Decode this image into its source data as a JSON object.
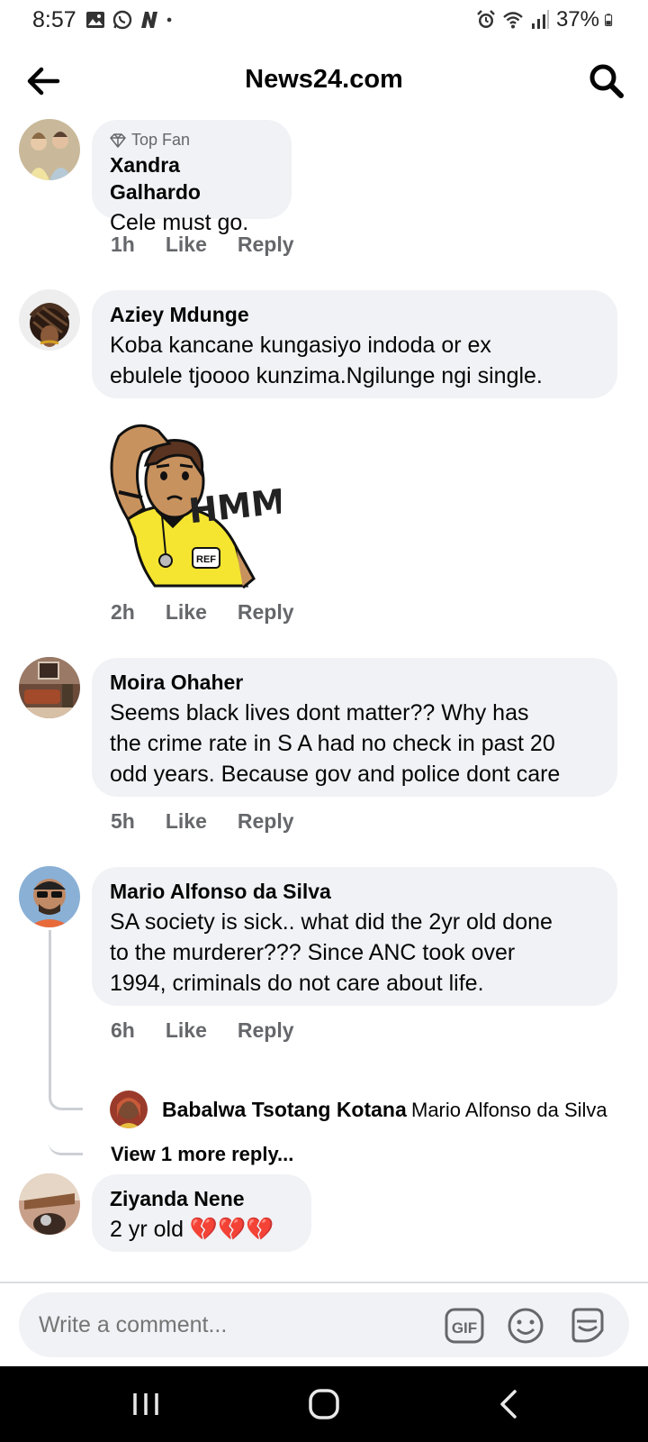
{
  "status_bar": {
    "time": "8:57",
    "battery": "37%",
    "icons_left": [
      "gallery-icon",
      "whatsapp-icon",
      "n-app-icon",
      "dot-icon"
    ],
    "icons_right": [
      "alarm-icon",
      "wifi-icon",
      "signal-icon",
      "battery-icon"
    ]
  },
  "header": {
    "title": "News24.com"
  },
  "comments": [
    {
      "badge": "Top Fan",
      "author": "Xandra Galhardo",
      "text": "Cele must go.",
      "time": "1h",
      "like": "Like",
      "reply": "Reply"
    },
    {
      "author": "Aziey Mdunge",
      "text_lines": [
        "Koba kancane kungasiyo indoda or ex",
        "ebulele tjoooo kunzima.Ngilunge ngi single."
      ],
      "sticker_text": "HMM...",
      "sticker_badge": "REF",
      "time": "2h",
      "like": "Like",
      "reply": "Reply"
    },
    {
      "author": "Moira Ohaher",
      "text_lines": [
        "Seems black lives dont matter?? Why has",
        "the crime rate in S A had no check in past 20",
        "odd years. Because gov and police dont care"
      ],
      "time": "5h",
      "like": "Like",
      "reply": "Reply"
    },
    {
      "author": "Mario Alfonso da Silva",
      "text_lines": [
        "SA society is sick.. what did the 2yr old done",
        "to the murderer??? Since ANC took over",
        "1994, criminals do not care about life."
      ],
      "time": "6h",
      "like": "Like",
      "reply": "Reply",
      "reply_preview": {
        "author": "Babalwa Tsotang Kotana",
        "text": "Mario Alfonso da Silva"
      },
      "view_more": "View 1 more reply..."
    },
    {
      "author": "Ziyanda Nene",
      "text": "2 yr old 💔💔💔"
    }
  ],
  "composer": {
    "placeholder": "Write a comment...",
    "gif_label": "GIF"
  },
  "colors": {
    "bubble": "#f0f2f5",
    "secondary_text": "#65676b",
    "primary_text": "#050505"
  }
}
